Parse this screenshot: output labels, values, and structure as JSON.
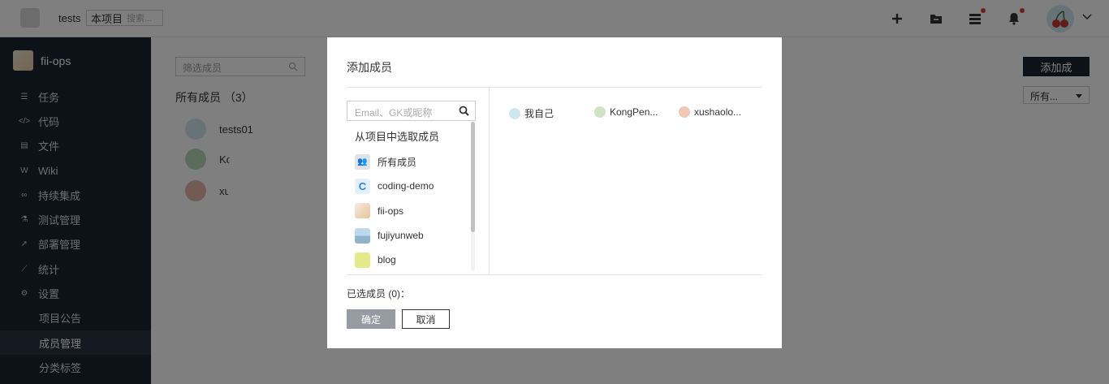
{
  "header": {
    "workspace_name": "tests",
    "scope_label": "本项目",
    "search_placeholder": "搜索..."
  },
  "sidebar": {
    "project_name": "fii-ops",
    "items": [
      {
        "label": "任务",
        "icon": "task-list-icon"
      },
      {
        "label": "代码",
        "icon": "code-icon"
      },
      {
        "label": "文件",
        "icon": "file-icon"
      },
      {
        "label": "Wiki",
        "icon": "wiki-icon"
      },
      {
        "label": "持续集成",
        "icon": "infinity-icon"
      },
      {
        "label": "测试管理",
        "icon": "flask-icon"
      },
      {
        "label": "部署管理",
        "icon": "rocket-icon"
      },
      {
        "label": "统计",
        "icon": "chart-icon"
      },
      {
        "label": "设置",
        "icon": "gears-icon"
      }
    ],
    "subitems": [
      {
        "label": "项目公告",
        "active": false
      },
      {
        "label": "成员管理",
        "active": true
      },
      {
        "label": "分类标签",
        "active": false
      }
    ]
  },
  "main": {
    "filter_placeholder": "筛选成员",
    "members_title": "所有成员 （3）",
    "add_button": "添加成",
    "role_filter": "所有...",
    "members": [
      {
        "name": "tests01"
      },
      {
        "name": "Ko"
      },
      {
        "name": "xu"
      }
    ]
  },
  "modal": {
    "title": "添加成员",
    "search_placeholder": "Email、GK或昵称",
    "source_header": "从项目中选取成员",
    "sources": [
      {
        "label": "所有成员",
        "icon": "group-icon"
      },
      {
        "label": "coding-demo",
        "icon": "coding-logo-icon"
      },
      {
        "label": "fii-ops",
        "icon": "project-thumb-icon"
      },
      {
        "label": "fujiyunweb",
        "icon": "landscape-icon"
      },
      {
        "label": "blog",
        "icon": "blog-thumb-icon"
      }
    ],
    "candidates": [
      {
        "name": "我自己"
      },
      {
        "name": "KongPen..."
      },
      {
        "name": "xushaolo..."
      }
    ],
    "selected_label": "已选成员 (0)：",
    "ok_label": "确定",
    "cancel_label": "取消"
  },
  "colors": {
    "sidebar_bg": "#1a2433",
    "overlay": "rgba(0,0,0,0.5)",
    "badge_red": "#e53935",
    "ok_button": "#979ba3"
  }
}
